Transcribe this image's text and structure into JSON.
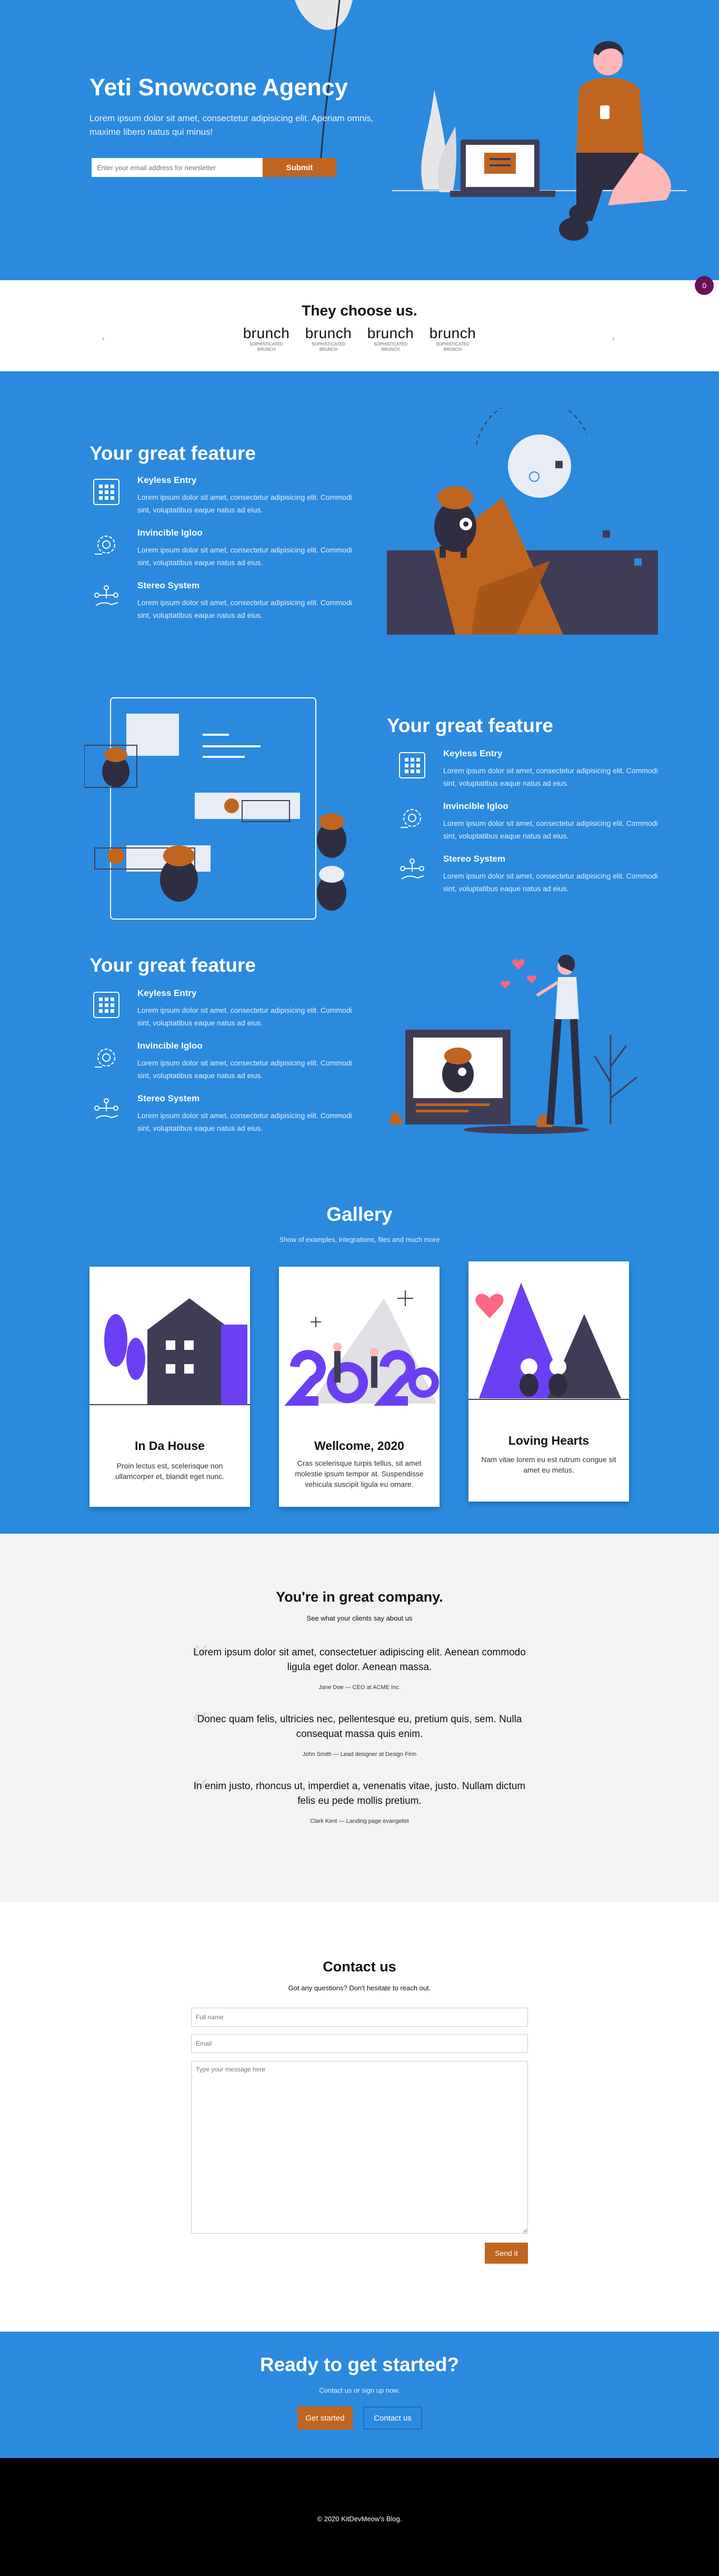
{
  "hero": {
    "title": "Yeti Snowcone Agency",
    "text": "Lorem ipsum dolor sit amet, consectetur adipisicing elit. Aperiam omnis, maxime libero natus qui minus!",
    "email_placeholder": "Enter your email address for newsletter",
    "submit_label": "Submit"
  },
  "badge": "0",
  "clients": {
    "title": "They choose us.",
    "logos": [
      {
        "word": "brunch",
        "sub": "SOPHISTICATED BRUNCH"
      },
      {
        "word": "brunch",
        "sub": "SOPHISTICATED BRUNCH"
      },
      {
        "word": "brunch",
        "sub": "SOPHISTICATED BRUNCH"
      },
      {
        "word": "brunch",
        "sub": "SOPHISTICATED BRUNCH"
      }
    ],
    "prev": "‹",
    "next": "›"
  },
  "features": [
    {
      "title": "Your great feature",
      "items": [
        {
          "title": "Keyless Entry",
          "text": "Lorem ipsum dolor sit amet, consectetur adipisicing elit. Commodi sint, voluptatibus eaque natus ad eius."
        },
        {
          "title": "Invincible Igloo",
          "text": "Lorem ipsum dolor sit amet, consectetur adipisicing elit. Commodi sint, voluptatibus eaque natus ad eius."
        },
        {
          "title": "Stereo System",
          "text": "Lorem ipsum dolor sit amet, consectetur adipisicing elit. Commodi sint, voluptatibus eaque natus ad eius."
        }
      ]
    },
    {
      "title": "Your great feature",
      "items": [
        {
          "title": "Keyless Entry",
          "text": "Lorem ipsum dolor sit amet, consectetur adipisicing elit. Commodi sint, voluptatibus eaque natus ad eius."
        },
        {
          "title": "Invincible Igloo",
          "text": "Lorem ipsum dolor sit amet, consectetur adipisicing elit. Commodi sint, voluptatibus eaque natus ad eius."
        },
        {
          "title": "Stereo System",
          "text": "Lorem ipsum dolor sit amet, consectetur adipisicing elit. Commodi sint, voluptatibus eaque natus ad eius."
        }
      ]
    },
    {
      "title": "Your great feature",
      "items": [
        {
          "title": "Keyless Entry",
          "text": "Lorem ipsum dolor sit amet, consectetur adipisicing elit. Commodi sint, voluptatibus eaque natus ad eius."
        },
        {
          "title": "Invincible Igloo",
          "text": "Lorem ipsum dolor sit amet, consectetur adipisicing elit. Commodi sint, voluptatibus eaque natus ad eius."
        },
        {
          "title": "Stereo System",
          "text": "Lorem ipsum dolor sit amet, consectetur adipisicing elit. Commodi sint, voluptatibus eaque natus ad eius."
        }
      ]
    }
  ],
  "gallery": {
    "title": "Gallery",
    "subtitle": "Show of examples, integrations, files and much more",
    "cards": [
      {
        "title": "In Da House",
        "text": "Proin lectus est, scelerisque non ullamcorper et, blandit eget nunc."
      },
      {
        "title": "Wellcome, 2020",
        "text": "Cras scelerisque turpis tellus, sit amet molestie ipsum tempor at. Suspendisse vehicula suscipit ligula eu ornare."
      },
      {
        "title": "Loving Hearts",
        "text": "Nam vitae lorem eu est rutrum congue sit amet eu metus."
      }
    ]
  },
  "testimonials": {
    "title": "You're in great company.",
    "subtitle": "See what your clients say about us",
    "quotes": [
      {
        "text": "Lorem ipsum dolor sit amet, consectetuer adipiscing elit. Aenean commodo ligula eget dolor. Aenean massa.",
        "author": "Jane Doe — CEO at ACME Inc."
      },
      {
        "text": "Donec quam felis, ultricies nec, pellentesque eu, pretium quis, sem. Nulla consequat massa quis enim.",
        "author": "John Smith — Lead designer at Design Firm"
      },
      {
        "text": "In enim justo, rhoncus ut, imperdiet a, venenatis vitae, justo. Nullam dictum felis eu pede mollis pretium.",
        "author": "Clark Kent — Landing page evangelist"
      }
    ]
  },
  "contact": {
    "title": "Contact us",
    "subtitle": "Got any questions? Don't hesitate to reach out.",
    "name_placeholder": "Full name",
    "email_placeholder": "Email",
    "message_placeholder": "Type your message here",
    "send_label": "Send it"
  },
  "cta": {
    "title": "Ready to get started?",
    "subtitle": "Contact us or sign up now.",
    "primary_label": "Get started",
    "secondary_label": "Contact us"
  },
  "footer": {
    "text": "© 2020 KitDevMeow's Blog."
  },
  "colors": {
    "brand_blue": "#2b8ade",
    "accent_orange": "#c0651f",
    "dark": "#3f3d56",
    "purple": "#6c3ff5"
  },
  "icons": {
    "keyless": "keypad-icon",
    "igloo": "gear-icon",
    "stereo": "network-hand-icon",
    "quote": "quote-icon"
  }
}
